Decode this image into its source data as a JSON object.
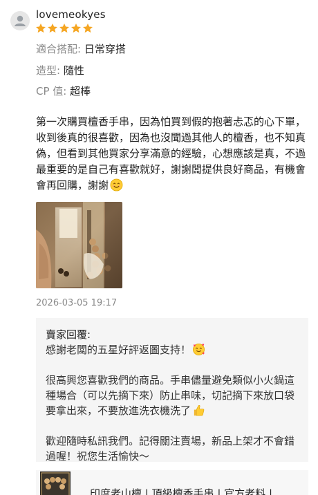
{
  "review": {
    "username": "lovemeokyes",
    "rating": 5,
    "attributes": [
      {
        "key": "適合搭配:",
        "value": "日常穿搭"
      },
      {
        "key": "造型:",
        "value": "隨性"
      },
      {
        "key": "CP 值:",
        "value": "超棒"
      }
    ],
    "text": "第一次購買檀香手串，因為怕買到假的抱著忐忑的心下單，收到後真的很喜歡，因為也沒聞過其他人的檀香，也不知真偽，但看到其他買家分享滿意的經驗，心想應該是真，不過最重要的是自己有喜歡就好，謝謝闆提供良好商品，有機會會再回購，謝謝",
    "date": "2026-03-05 19:17"
  },
  "seller_reply": {
    "title": "賣家回覆:",
    "para1": "感謝老闆的五星好評返圖支持！",
    "para2": "很高興您喜歡我們的商品。手串儘量避免類似小火鍋這種場合（可以先摘下來）防止串味，切記摘下來放口袋要拿出來，不要放進洗衣機洗了",
    "para3": "歡迎隨時私訊我們。記得關注賣場，新品上架才不會錯過喔！祝您生活愉快～"
  },
  "product": {
    "name": "印度老山檀 | 頂級檀香手串 | 官方老料 | ..."
  },
  "colors": {
    "star": "#f5a623",
    "reply_bg": "#f5f5f5",
    "muted": "#8a8a8a"
  }
}
